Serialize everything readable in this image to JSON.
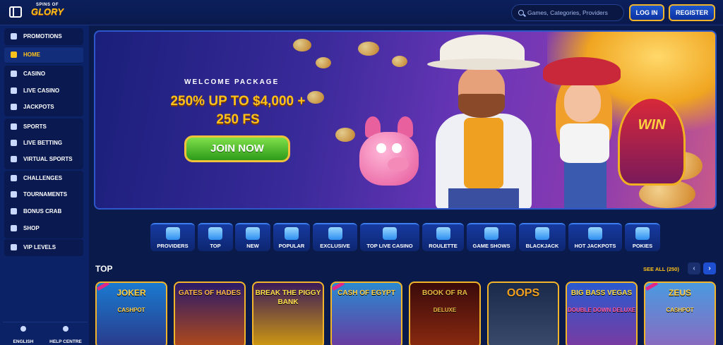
{
  "header": {
    "logo_top": "SPINS OF",
    "logo_main": "GLORY",
    "search_placeholder": "Games, Categories, Providers",
    "login_label": "LOG IN",
    "register_label": "REGISTER"
  },
  "sidebar": {
    "items": [
      {
        "label": "PROMOTIONS",
        "icon": "gift-icon"
      },
      {
        "label": "HOME",
        "icon": "home-icon"
      },
      {
        "label": "CASINO",
        "icon": "slot-icon"
      },
      {
        "label": "LIVE CASINO",
        "icon": "cards-icon"
      },
      {
        "label": "JACKPOTS",
        "icon": "clover-icon"
      },
      {
        "label": "SPORTS",
        "icon": "ball-icon"
      },
      {
        "label": "LIVE BETTING",
        "icon": "live-icon"
      },
      {
        "label": "VIRTUAL SPORTS",
        "icon": "gamepad-icon"
      },
      {
        "label": "CHALLENGES",
        "icon": "medal-icon"
      },
      {
        "label": "TOURNAMENTS",
        "icon": "globe-icon"
      },
      {
        "label": "BONUS CRAB",
        "icon": "crab-icon"
      },
      {
        "label": "SHOP",
        "icon": "basket-icon"
      },
      {
        "label": "VIP LEVELS",
        "icon": "vip-icon"
      }
    ],
    "footer": {
      "language": "ENGLISH",
      "help": "HELP CENTRE"
    }
  },
  "hero": {
    "subtitle": "WELCOME PACKAGE",
    "title_line1": "250% UP TO $4,000 +",
    "title_line2": "250 FS",
    "cta": "JOIN NOW",
    "wheel_text": "WIN"
  },
  "categories": [
    {
      "label": "PROVIDERS",
      "icon": "book-icon"
    },
    {
      "label": "TOP",
      "icon": "crown-icon"
    },
    {
      "label": "NEW",
      "icon": "rocket-icon"
    },
    {
      "label": "POPULAR",
      "icon": "star-icon"
    },
    {
      "label": "EXCLUSIVE",
      "icon": "diamond-icon"
    },
    {
      "label": "TOP LIVE CASINO",
      "icon": "bowtie-icon"
    },
    {
      "label": "ROULETTE",
      "icon": "roulette-icon"
    },
    {
      "label": "GAME SHOWS",
      "icon": "microphone-icon"
    },
    {
      "label": "BLACKJACK",
      "icon": "spade-icon"
    },
    {
      "label": "HOT JACKPOTS",
      "icon": "flame-icon"
    },
    {
      "label": "POKIES",
      "icon": "slot-machine-icon"
    }
  ],
  "section": {
    "title": "TOP",
    "see_all": "SEE ALL (250)",
    "prev": "‹",
    "next": "›"
  },
  "games": [
    {
      "name": "JOKER",
      "sub": "CASHPOT"
    },
    {
      "name": "GATES OF HADES",
      "sub": ""
    },
    {
      "name": "BREAK THE PIGGY BANK",
      "sub": ""
    },
    {
      "name": "CASH OF EGYPT",
      "sub": ""
    },
    {
      "name": "BOOK OF RA",
      "sub": "DELUXE"
    },
    {
      "name": "OOPS",
      "sub": ""
    },
    {
      "name": "BIG BASS VEGAS",
      "sub": "DOUBLE DOWN DELUXE"
    },
    {
      "name": "ZEUS",
      "sub": "CASHPOT"
    }
  ]
}
